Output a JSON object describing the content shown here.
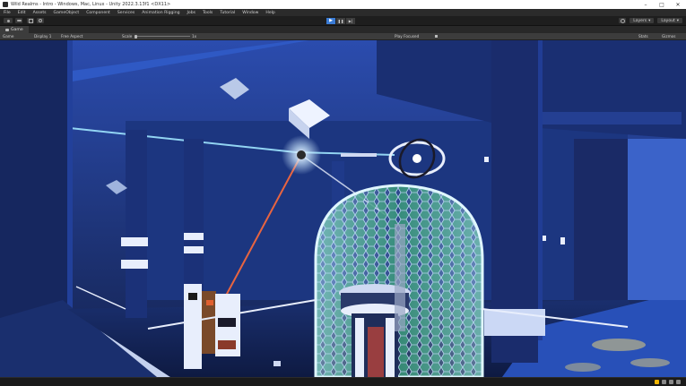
{
  "window": {
    "title": "Wild Realms - Intro - Windows, Mac, Linux - Unity 2022.3.13f1 <DX11>",
    "minimize_glyph": "–",
    "maximize_glyph": "□",
    "close_glyph": "✕"
  },
  "menu": {
    "items": [
      "File",
      "Edit",
      "Assets",
      "GameObject",
      "Component",
      "Services",
      "Animation Rigging",
      "Jobs",
      "Tools",
      "Tutorial",
      "Window",
      "Help"
    ]
  },
  "toolbar": {
    "play_glyph": "▶",
    "pause_glyph": "❚❚",
    "step_glyph": "▶|",
    "layers_label": "Layers",
    "layout_label": "Layout"
  },
  "game_tab": {
    "label": "Game"
  },
  "game_bar": {
    "display_label": "Game",
    "display_select": "Display 1",
    "aspect_select": "Free Aspect",
    "scale_label": "Scale",
    "scale_value": "1x",
    "play_mode_select": "Play Focused",
    "stats_label": "Stats",
    "gizmos_label": "Gizmos"
  },
  "colors": {
    "accent_play": "#3a7bd5",
    "glass_glow": "#bfe9ff",
    "laser": "#ff6a3a",
    "wall_blue": "#1f3f8f"
  }
}
